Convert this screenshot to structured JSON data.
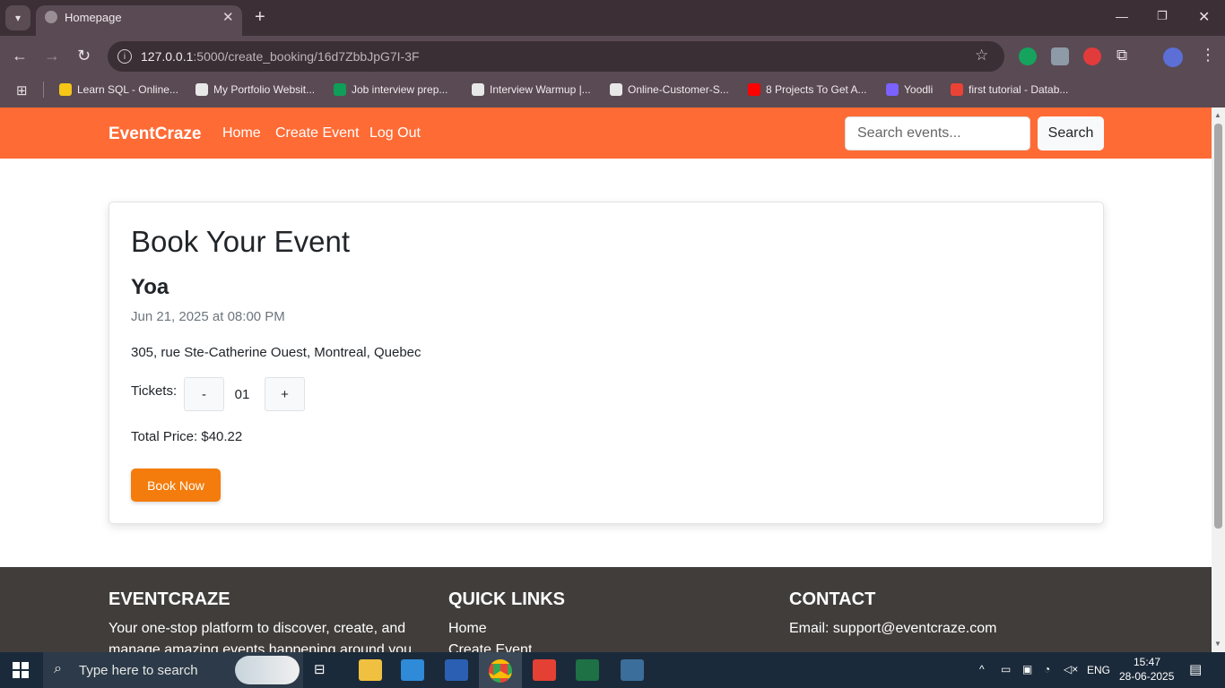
{
  "browser": {
    "tab_title": "Homepage",
    "url_host": "127.0.0.1",
    "url_path": ":5000/create_booking/16d7ZbbJpG7I-3F",
    "bookmarks": [
      {
        "label": "Learn SQL - Online...",
        "color": "#f5c518"
      },
      {
        "label": "My Portfolio Websit...",
        "color": "#e8e8e8"
      },
      {
        "label": "Job interview prep...",
        "color": "#0f9d58"
      },
      {
        "label": "Interview Warmup |...",
        "color": "#e8e8e8"
      },
      {
        "label": "Online-Customer-S...",
        "color": "#e8e8e8"
      },
      {
        "label": "8 Projects To Get A...",
        "color": "#ff0000"
      },
      {
        "label": "Yoodli",
        "color": "#7b61ff"
      },
      {
        "label": "first tutorial - Datab...",
        "color": "#ea4335"
      }
    ]
  },
  "navbar": {
    "brand": "EventCraze",
    "links": [
      "Home",
      "Create Event",
      "Log Out"
    ],
    "search_placeholder": "Search events...",
    "search_button": "Search",
    "color": "#ff6b35"
  },
  "booking": {
    "title": "Book Your Event",
    "event_name": "Yoa",
    "date": "Jun 21, 2025 at 08:00 PM",
    "address": "305, rue Ste-Catherine Ouest, Montreal, Quebec",
    "tickets_label": "Tickets:",
    "decrement": "-",
    "quantity": "01",
    "increment": "+",
    "total_price": "Total Price: $40.22",
    "book_button": "Book Now",
    "button_color": "#f47c0c"
  },
  "footer": {
    "about_heading": "EVENTCRAZE",
    "about_text_1": "Your one-stop platform to discover, create, and",
    "about_text_2": "manage amazing events happening around you.",
    "links_heading": "QUICK LINKS",
    "link_1": "Home",
    "link_2": "Create Event",
    "contact_heading": "CONTACT",
    "email": "Email: support@eventcraze.com"
  },
  "taskbar": {
    "search_text": "Type here to search",
    "lang": "ENG",
    "time": "15:47",
    "date": "28-06-2025"
  }
}
